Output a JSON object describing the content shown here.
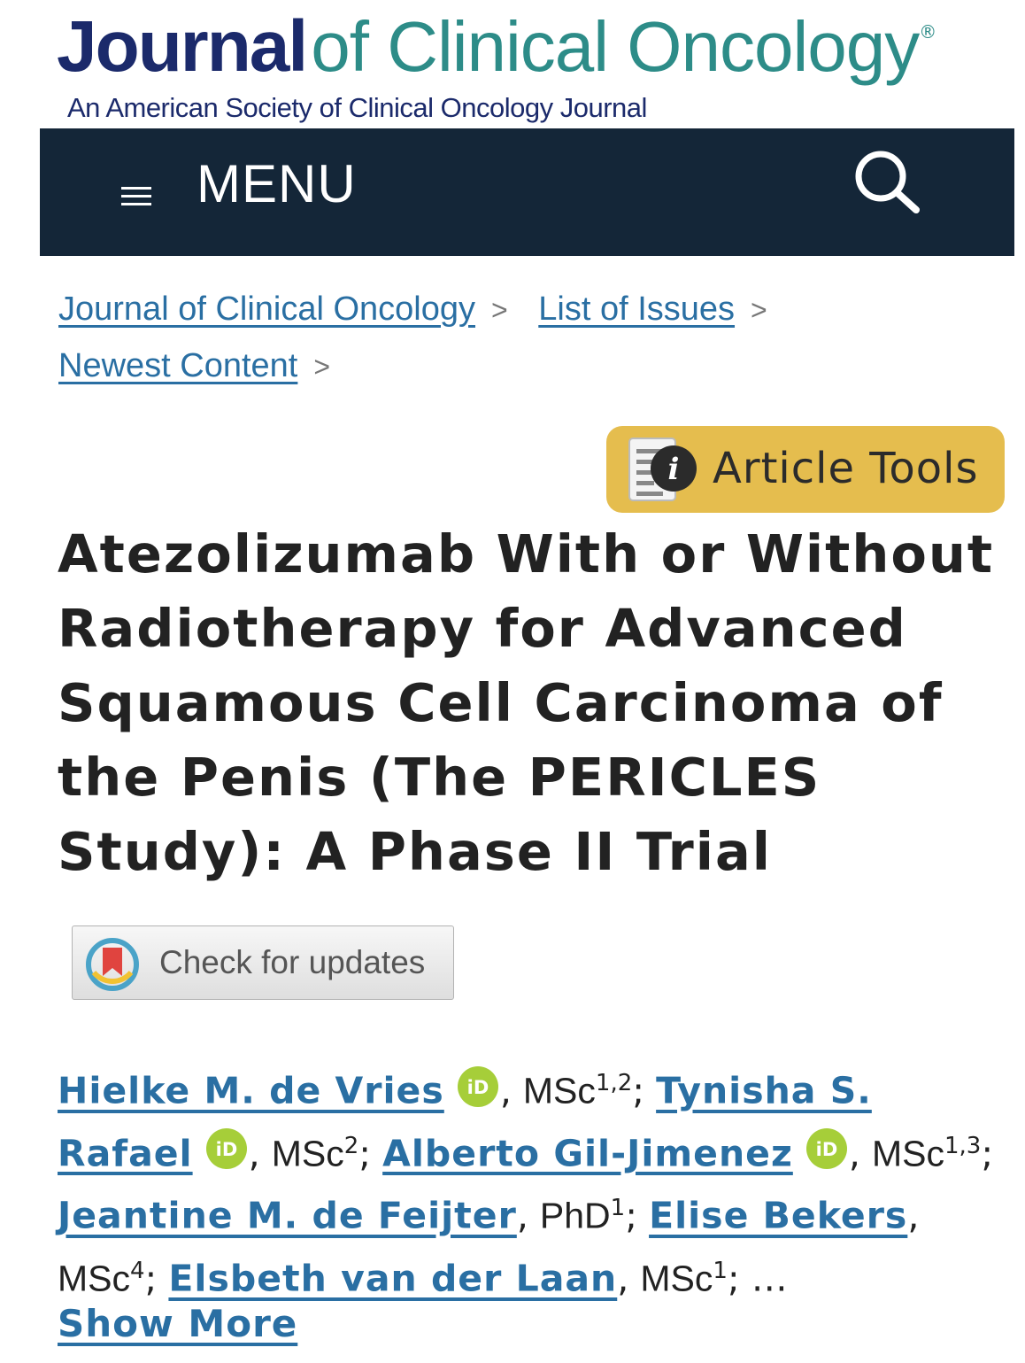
{
  "header": {
    "logo_journal": "Journal",
    "logo_rest": "of Clinical Oncology",
    "logo_reg": "®",
    "subtitle": "An American Society of Clinical Oncology Journal"
  },
  "nav": {
    "menu_label": "MENU",
    "menu_icon": "hamburger-icon",
    "search_icon": "search-icon"
  },
  "breadcrumb": {
    "items": [
      "Journal of Clinical Oncology",
      "List of Issues",
      "Newest Content"
    ],
    "separator": ">"
  },
  "tools": {
    "label": "Article Tools",
    "icon": "info-document-icon",
    "color": "#e5bd4e"
  },
  "article": {
    "title": "Atezolizumab With or Without Radiotherapy for Advanced Squamous Cell Carcinoma of the Penis (The PERICLES Study): A Phase II Trial"
  },
  "updates": {
    "label": "Check for updates"
  },
  "authors": [
    {
      "name": "Hielke M. de Vries",
      "degree": "MSc",
      "aff": "1,2",
      "orcid": true
    },
    {
      "name": "Tynisha S. Rafael",
      "degree": "MSc",
      "aff": "2",
      "orcid": true
    },
    {
      "name": "Alberto Gil-Jimenez",
      "degree": "MSc",
      "aff": "1,3",
      "orcid": true
    },
    {
      "name": "Jeantine M. de Feijter",
      "degree": "PhD",
      "aff": "1",
      "orcid": false
    },
    {
      "name": "Elise Bekers",
      "degree": "MSc",
      "aff": "4",
      "orcid": false
    },
    {
      "name": "Elsbeth van der Laan",
      "degree": "MSc",
      "aff": "1",
      "orcid": false
    }
  ],
  "authors_ellipsis": "…",
  "show_more": "Show More",
  "colors": {
    "navbar": "#142638",
    "link": "#2a6fa3",
    "brand_navy": "#1b2a6b",
    "brand_teal": "#2d8c88",
    "orcid": "#a6ce39"
  }
}
